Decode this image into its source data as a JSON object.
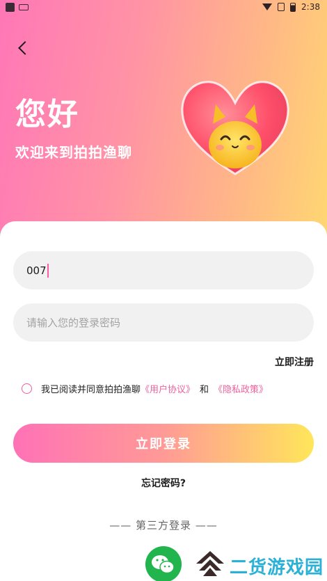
{
  "status_bar": {
    "time": "2:38",
    "icons": [
      "app-icon",
      "notification-icon",
      "wifi-icon",
      "no-sim-icon",
      "battery-icon"
    ]
  },
  "header": {
    "back_icon": "chevron-left-icon",
    "greeting": "您好",
    "welcome": "欢迎来到拍拍渔聊"
  },
  "form": {
    "account_value": "007",
    "password_placeholder": "请输入您的登录密码",
    "register_label": "立即注册",
    "agreement": {
      "prefix": "我已阅读并同意拍拍渔聊",
      "user_agreement": "《用户协议》",
      "and": "和",
      "privacy_policy": "《隐私政策》"
    },
    "login_label": "立即登录",
    "forgot_label": "忘记密码?"
  },
  "third_party": {
    "divider_label": "—— 第三方登录 ——",
    "icons": [
      "wechat-icon"
    ]
  },
  "watermark": {
    "text": "二货游戏园"
  },
  "colors": {
    "accent_pink": "#f0609e",
    "gradient_start": "#ff72b6",
    "gradient_end": "#ffe65a",
    "wechat_green": "#22b44d"
  }
}
